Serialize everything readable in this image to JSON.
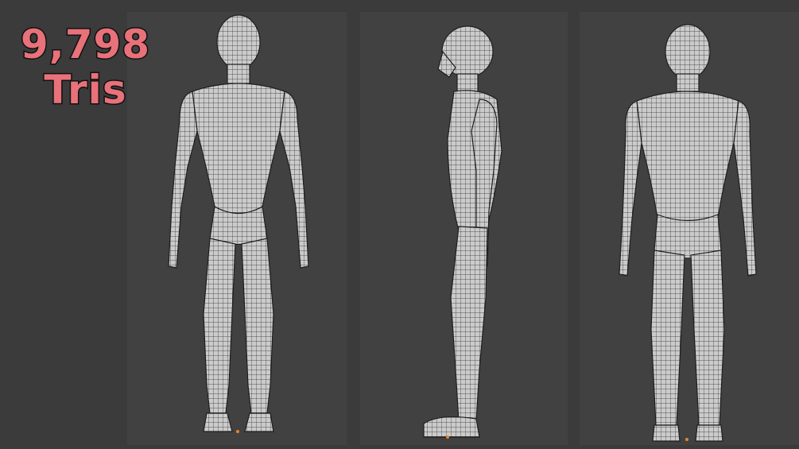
{
  "overlay": {
    "triangle_count": "9,798",
    "triangle_unit": "Tris",
    "text_color": "#e8717a"
  },
  "viewports": {
    "front": {
      "view": "front"
    },
    "side": {
      "view": "side"
    },
    "back": {
      "view": "back"
    }
  },
  "colors": {
    "background": "#3b3b3b",
    "viewport": "#414141",
    "mesh_fill": "#c9c9c9",
    "wire": "#2a2a2a",
    "origin_dot": "#e5852a"
  }
}
